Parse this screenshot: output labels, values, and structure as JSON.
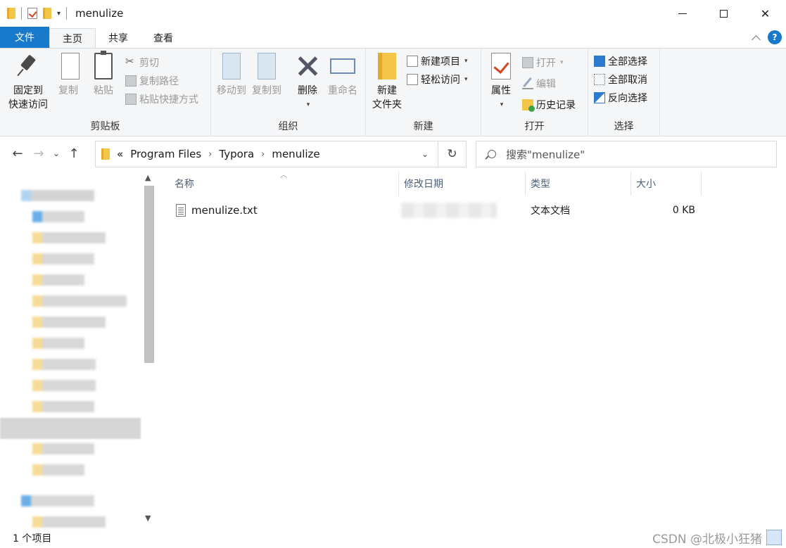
{
  "window": {
    "title": "menulize"
  },
  "ribbon_tabs": [
    "文件",
    "主页",
    "共享",
    "查看"
  ],
  "ribbon": {
    "clipboard": {
      "pin": "固定到\n快速访问",
      "pin_l1": "固定到",
      "pin_l2": "快速访问",
      "copy": "复制",
      "paste": "粘贴",
      "cut": "剪切",
      "copy_path": "复制路径",
      "paste_shortcut": "粘贴快捷方式",
      "label": "剪贴板"
    },
    "organize": {
      "move_to": "移动到",
      "copy_to": "复制到",
      "delete": "删除",
      "rename": "重命名",
      "label": "组织"
    },
    "new": {
      "new_folder_l1": "新建",
      "new_folder_l2": "文件夹",
      "new_item": "新建项目",
      "easy_access": "轻松访问",
      "label": "新建"
    },
    "open": {
      "properties": "属性",
      "open": "打开",
      "edit": "编辑",
      "history": "历史记录",
      "label": "打开"
    },
    "select": {
      "select_all": "全部选择",
      "select_none": "全部取消",
      "invert": "反向选择",
      "label": "选择"
    }
  },
  "address": {
    "prefix": "«",
    "crumbs": [
      "Program Files",
      "Typora",
      "menulize"
    ]
  },
  "search": {
    "placeholder": "搜索\"menulize\""
  },
  "columns": {
    "name": "名称",
    "modified": "修改日期",
    "type": "类型",
    "size": "大小"
  },
  "files": [
    {
      "name": "menulize.txt",
      "type": "文本文档",
      "size": "0 KB"
    }
  ],
  "status": {
    "count": "1 个项目"
  },
  "watermark": "CSDN @北极小狂猪"
}
